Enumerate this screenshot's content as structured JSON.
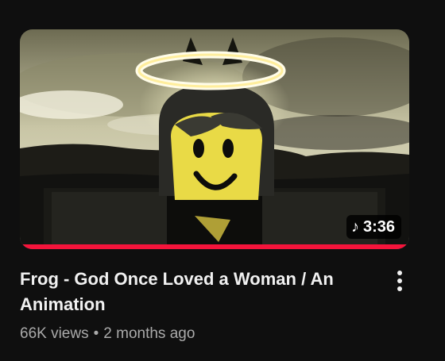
{
  "video": {
    "title": "Frog - God Once Loved a Woman / An Animation",
    "duration": "3:36",
    "duration_icon": "music-note-icon",
    "views": "66K views",
    "separator": "•",
    "age": "2 months ago",
    "watch_progress": 1.0,
    "progress_color": "#f5143b",
    "menu_icon": "more-vert-icon"
  }
}
